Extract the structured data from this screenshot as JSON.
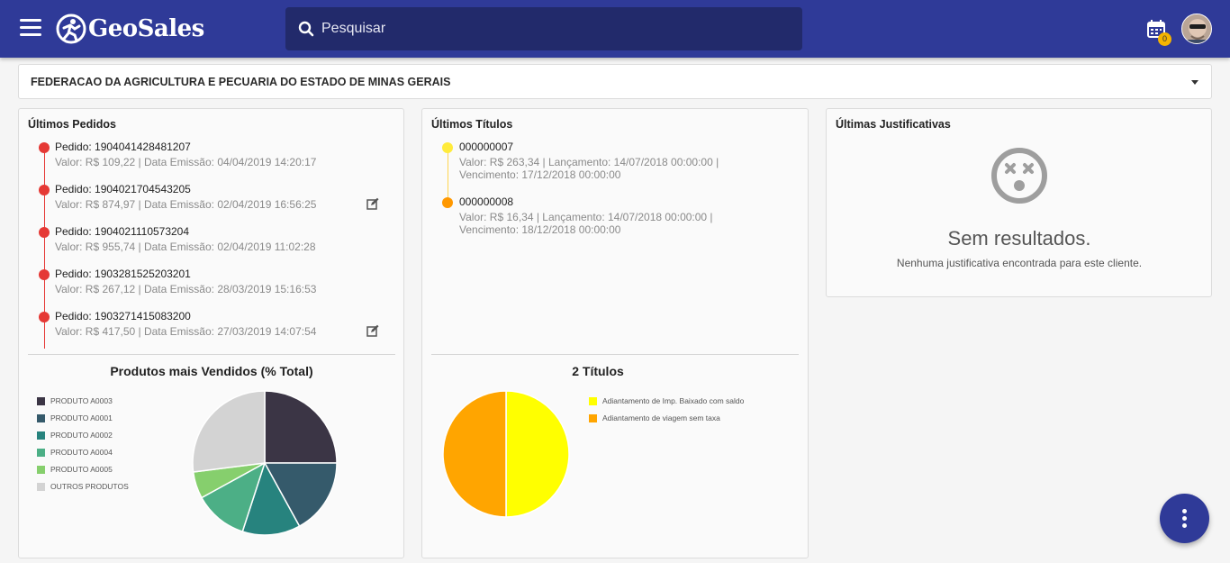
{
  "header": {
    "brand": "GeoSales",
    "search_placeholder": "Pesquisar",
    "calendar_badge": "0",
    "accent": "#2f3a98"
  },
  "client_select": {
    "value": "FEDERACAO DA AGRICULTURA E PECUARIA DO ESTADO DE MINAS GERAIS"
  },
  "orders_card": {
    "title": "Últimos Pedidos",
    "items": [
      {
        "line1": "Pedido: 1904041428481207",
        "line2": "Valor: R$ 109,22 | Data Emissão: 04/04/2019 14:20:17",
        "editable": false
      },
      {
        "line1": "Pedido: 1904021704543205",
        "line2": "Valor: R$ 874,97 | Data Emissão: 02/04/2019 16:56:25",
        "editable": true
      },
      {
        "line1": "Pedido: 1904021110573204",
        "line2": "Valor: R$ 955,74 | Data Emissão: 02/04/2019 11:02:28",
        "editable": false
      },
      {
        "line1": "Pedido: 1903281525203201",
        "line2": "Valor: R$ 267,12 | Data Emissão: 28/03/2019 15:16:53",
        "editable": false
      },
      {
        "line1": "Pedido: 1903271415083200",
        "line2": "Valor: R$ 417,50 | Data Emissão: 27/03/2019 14:07:54",
        "editable": true
      }
    ]
  },
  "titles_card": {
    "title": "Últimos Títulos",
    "items": [
      {
        "number": "000000007",
        "line2": "Valor: R$ 263,34 | Lançamento: 14/07/2018 00:00:00 |",
        "line3": "Vencimento: 17/12/2018 00:00:00",
        "color": "#ffeb3b"
      },
      {
        "number": "000000008",
        "line2": "Valor: R$ 16,34 | Lançamento: 14/07/2018 00:00:00 |",
        "line3": "Vencimento: 18/12/2018 00:00:00",
        "color": "#ff9800"
      }
    ]
  },
  "justifications_card": {
    "title": "Últimas Justificativas",
    "empty_title": "Sem resultados.",
    "empty_subtitle": "Nenhuma justificativa encontrada para este cliente."
  },
  "chart_data": [
    {
      "type": "pie",
      "title": "Produtos mais Vendidos (% Total)",
      "categories": [
        "PRODUTO A0003",
        "PRODUTO A0001",
        "PRODUTO A0002",
        "PRODUTO A0004",
        "PRODUTO A0005",
        "OUTROS PRODUTOS"
      ],
      "values": [
        25,
        17,
        13,
        12,
        6,
        27
      ],
      "colors": [
        "#3b3545",
        "#355a6b",
        "#27837e",
        "#4caf86",
        "#86cf6d",
        "#d3d3d3"
      ],
      "legend": "left"
    },
    {
      "type": "pie",
      "title": "2 Títulos",
      "categories": [
        "Adiantamento de Imp. Baixado com saldo",
        "Adiantamento de viagem sem taxa"
      ],
      "values": [
        50,
        50
      ],
      "colors": [
        "#ffff00",
        "#ffa500"
      ],
      "legend": "right"
    }
  ]
}
